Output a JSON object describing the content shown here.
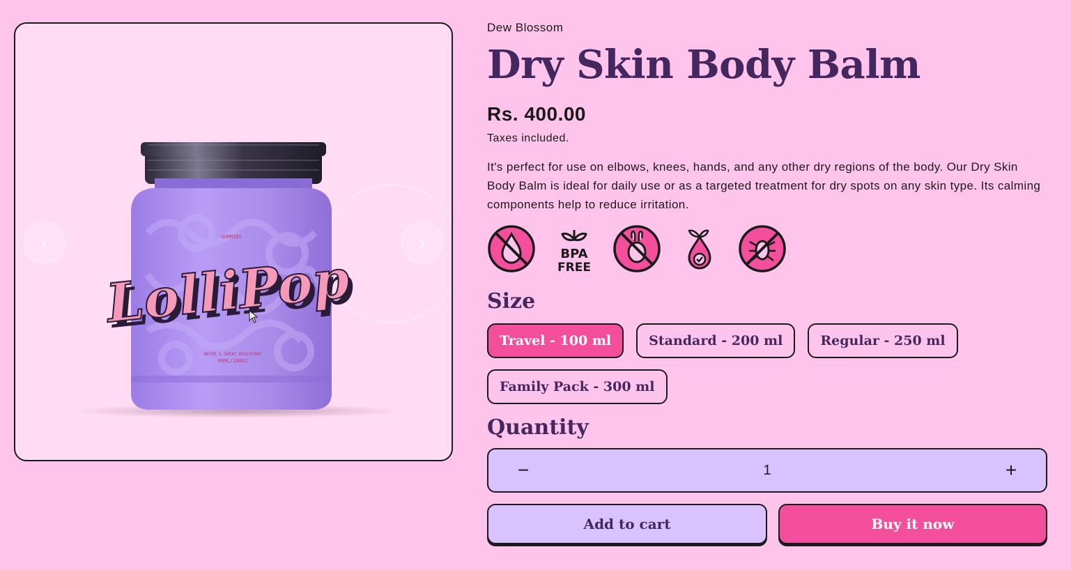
{
  "gallery": {
    "prev_icon": "chevron-left",
    "next_icon": "chevron-right",
    "jar": {
      "brand_small": "GUMMIES",
      "brand_script": "LolliPop",
      "caption1": "WATER & SWEAT RESISTANT",
      "caption2": "80ML/100OZ"
    }
  },
  "product": {
    "vendor": "Dew Blossom",
    "title": "Dry Skin Body Balm",
    "price": "Rs. 400.00",
    "tax_note": "Taxes included.",
    "description": "It's perfect for use on elbows, knees, hands, and any other dry regions of the body. Our Dry Skin Body Balm is ideal for daily use or as a targeted treatment for dry spots on any skin type. Its calming components help to reduce irritation."
  },
  "badges": [
    {
      "icon": "no-drop-icon"
    },
    {
      "icon": "bpa-free-icon",
      "line1": "BPA",
      "line2": "FREE"
    },
    {
      "icon": "cruelty-free-icon"
    },
    {
      "icon": "natural-drop-icon"
    },
    {
      "icon": "no-bug-icon"
    }
  ],
  "size": {
    "label": "Size",
    "options": [
      "Travel - 100 ml",
      "Standard - 200 ml",
      "Regular - 250 ml",
      "Family Pack - 300 ml"
    ],
    "selected": "Travel - 100 ml"
  },
  "quantity": {
    "label": "Quantity",
    "minus": "−",
    "value": "1",
    "plus": "+"
  },
  "actions": {
    "add_to_cart": "Add to cart",
    "buy_now": "Buy it now"
  },
  "colors": {
    "background": "#ffc4ec",
    "title": "#45275f",
    "accent_pink": "#f44f9c",
    "lavender": "#d8c2ff"
  }
}
